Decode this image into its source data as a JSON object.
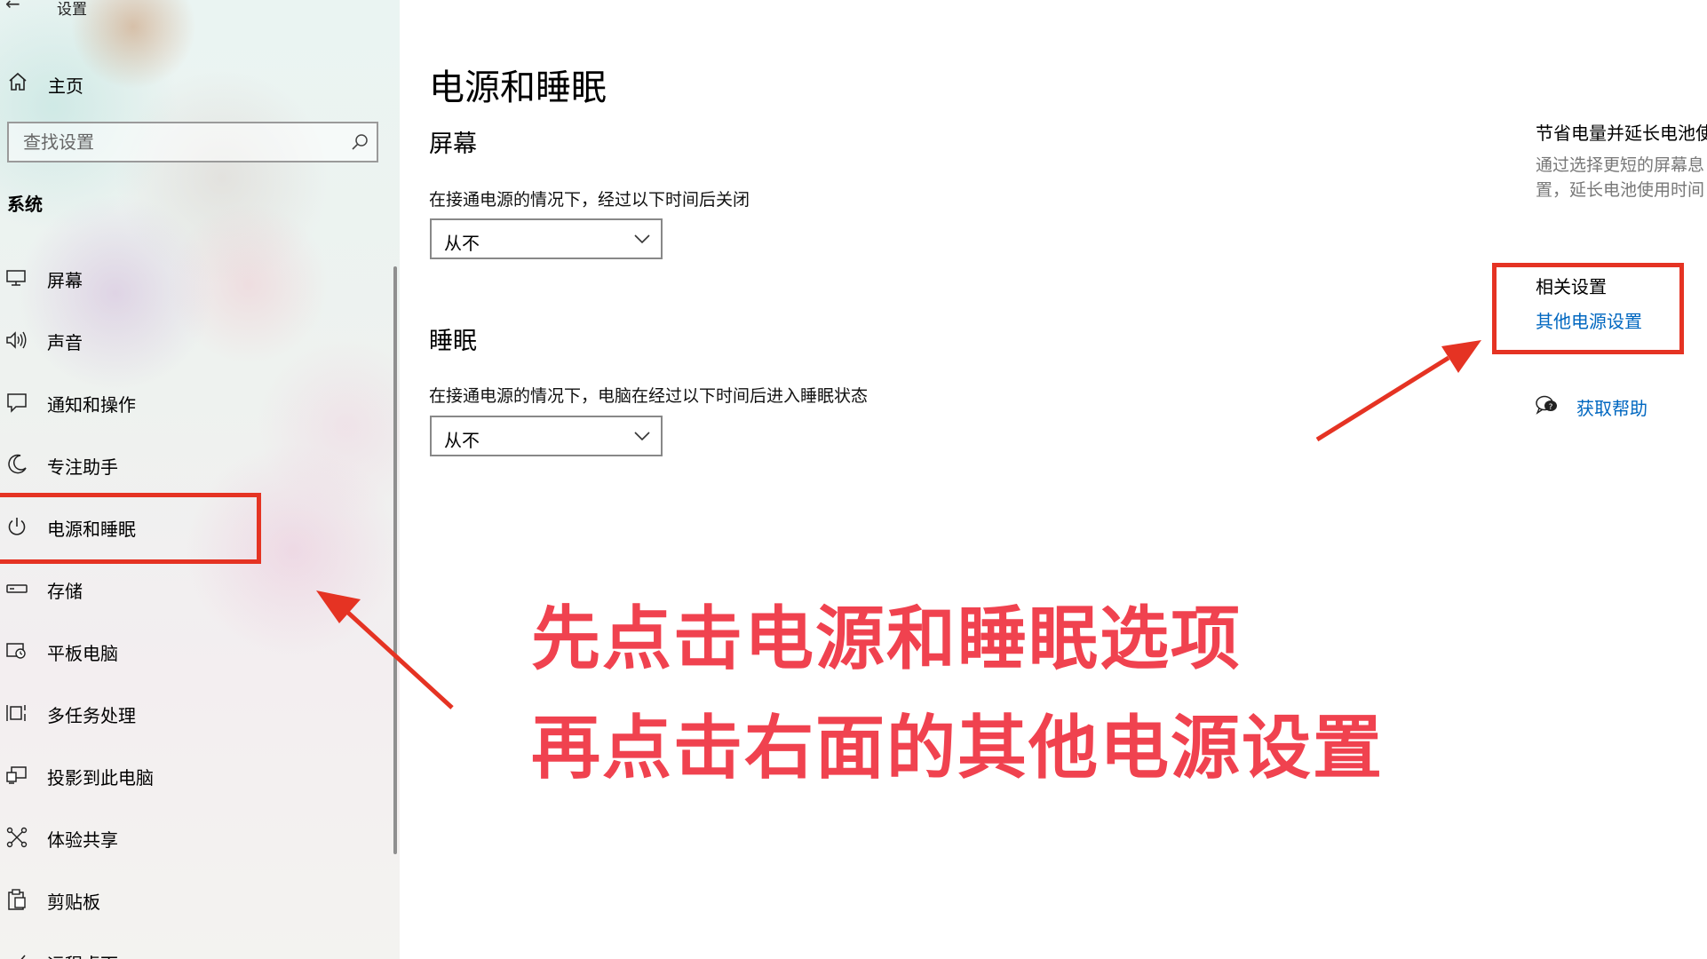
{
  "window": {
    "title": "设置",
    "back_icon": "back-arrow-icon"
  },
  "sidebar": {
    "home_label": "主页",
    "search_placeholder": "查找设置",
    "section_label": "系统",
    "items": [
      {
        "label": "屏幕",
        "icon": "monitor-icon"
      },
      {
        "label": "声音",
        "icon": "speaker-icon"
      },
      {
        "label": "通知和操作",
        "icon": "message-icon"
      },
      {
        "label": "专注助手",
        "icon": "moon-icon"
      },
      {
        "label": "电源和睡眠",
        "icon": "power-icon",
        "selected": true
      },
      {
        "label": "存储",
        "icon": "storage-icon"
      },
      {
        "label": "平板电脑",
        "icon": "tablet-icon"
      },
      {
        "label": "多任务处理",
        "icon": "multitask-icon"
      },
      {
        "label": "投影到此电脑",
        "icon": "project-icon"
      },
      {
        "label": "体验共享",
        "icon": "share-icon"
      },
      {
        "label": "剪贴板",
        "icon": "clipboard-icon"
      },
      {
        "label": "远程桌面",
        "icon": "remote-icon"
      }
    ]
  },
  "main": {
    "title": "电源和睡眠",
    "screen": {
      "title": "屏幕",
      "desc": "在接通电源的情况下，经过以下时间后关闭",
      "value": "从不"
    },
    "sleep": {
      "title": "睡眠",
      "desc": "在接通电源的情况下，电脑在经过以下时间后进入睡眠状态",
      "value": "从不"
    },
    "side": {
      "heading": "节省电量并延长电池使",
      "desc_line1": "通过选择更短的屏幕息",
      "desc_line2": "置，延长电池使用时间",
      "related_title": "相关设置",
      "related_link": "其他电源设置",
      "help_link": "获取帮助"
    }
  },
  "annotation": {
    "line1": "先点击电源和睡眠选项",
    "line2": "再点击右面的其他电源设置",
    "color": "#f0424f"
  },
  "colors": {
    "link": "#0067c0",
    "highlight": "#e53323"
  }
}
